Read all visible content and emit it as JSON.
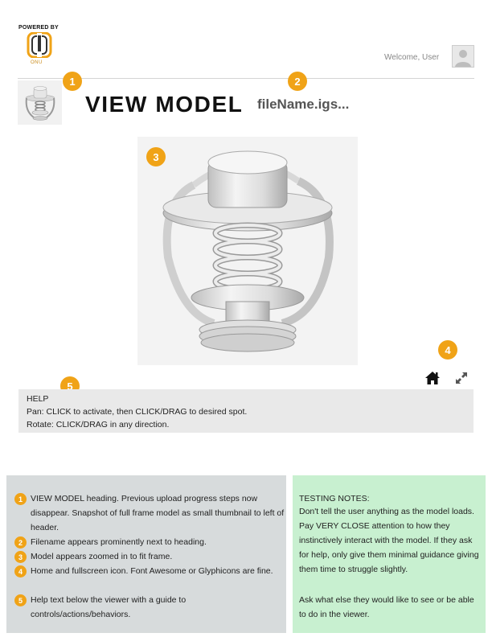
{
  "header": {
    "powered_by": "POWERED BY",
    "logo_text": "ONU",
    "welcome": "Welcome, User"
  },
  "badges": [
    "1",
    "2",
    "3",
    "4",
    "5"
  ],
  "page": {
    "title": "VIEW MODEL",
    "filename": "fileName.igs..."
  },
  "help": {
    "heading": "HELP",
    "lines": [
      "Pan:  CLICK to activate, then CLICK/DRAG to desired spot.",
      "Rotate: CLICK/DRAG in any direction."
    ]
  },
  "annotations": [
    {
      "num": "1",
      "text": "VIEW MODEL heading.  Previous upload progress steps now disappear. Snapshot of full frame model as small thumbnail to left of header."
    },
    {
      "num": "2",
      "text": "Filename appears prominently next to heading."
    },
    {
      "num": "3",
      "text": "Model appears zoomed in to fit frame."
    },
    {
      "num": "4",
      "text": "Home and fullscreen icon. Font Awesome or Glyphicons are fine."
    },
    {
      "num": "5",
      "text": "Help text below the viewer with a guide to controls/actions/behaviors."
    }
  ],
  "testing_notes": {
    "heading": "TESTING NOTES:",
    "paragraph1": "Don't tell the user anything as the model loads.  Pay VERY CLOSE attention to how they instinctively interact with the model.  If they ask for help, only give them minimal guidance giving them time to struggle slightly.",
    "paragraph2": "Ask what else they would like to see or be able to do in the viewer."
  },
  "colors": {
    "badge": "#f0a317",
    "notes_left_bg": "#d7dbdc",
    "notes_right_bg": "#c8f0d0",
    "help_bg": "#e9e9e9"
  },
  "icons": [
    "home-icon",
    "fullscreen-icon",
    "user-avatar-icon",
    "onu-logo-icon"
  ]
}
